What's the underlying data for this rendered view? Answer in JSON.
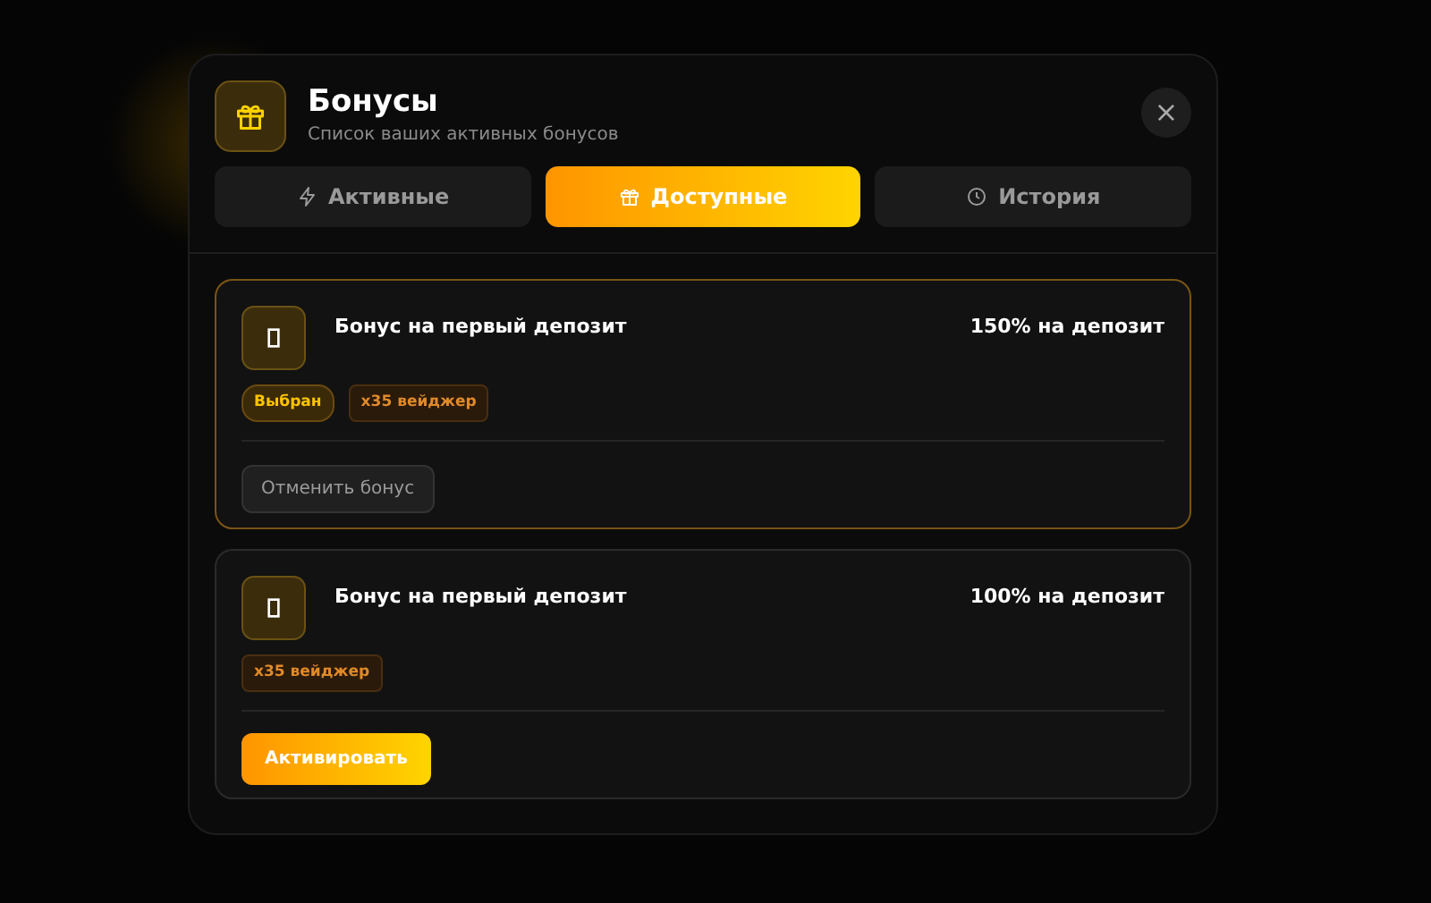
{
  "header": {
    "title": "Бонусы",
    "subtitle": "Список ваших активных бонусов",
    "close": "×"
  },
  "tabs": [
    {
      "label": "Активные",
      "selected": false
    },
    {
      "label": "Доступные",
      "selected": true
    },
    {
      "label": "История",
      "selected": false
    }
  ],
  "bonuses": [
    {
      "title": "Бонус на первый депозит",
      "amount": "150% на депозит",
      "selected": true,
      "tags": [
        {
          "kind": "status",
          "text": "Выбран"
        },
        {
          "kind": "wager",
          "text": "x35 вейджер"
        }
      ],
      "button": {
        "kind": "cancel",
        "label": "Отменить бонус"
      }
    },
    {
      "title": "Бонус на первый депозит",
      "amount": "100% на депозит",
      "selected": false,
      "tags": [
        {
          "kind": "wager",
          "text": "x35 вейджер"
        }
      ],
      "button": {
        "kind": "activate",
        "label": "Активировать"
      }
    }
  ]
}
